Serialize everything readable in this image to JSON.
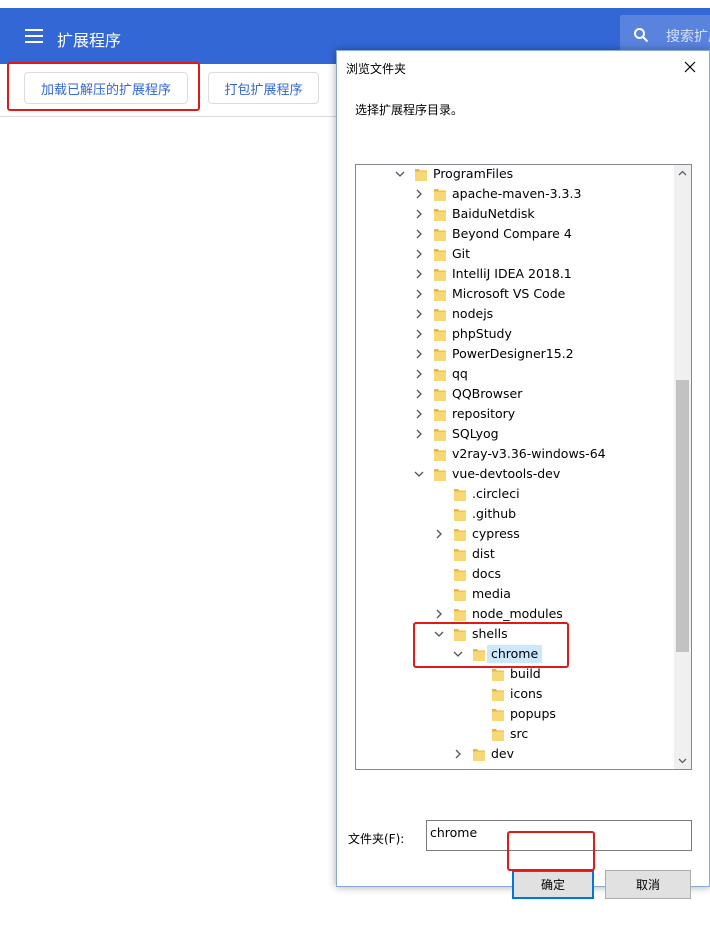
{
  "header": {
    "title": "扩展程序",
    "search_placeholder": "搜索扩展"
  },
  "toolbar": {
    "load_unpacked_label": "加载已解压的扩展程序",
    "pack_label": "打包扩展程序"
  },
  "dialog": {
    "title": "浏览文件夹",
    "instruction": "选择扩展程序目录。",
    "tree": [
      {
        "label": "ProgramFiles",
        "depth": 0,
        "expander": "expanded"
      },
      {
        "label": "apache-maven-3.3.3",
        "depth": 1,
        "expander": "collapsed"
      },
      {
        "label": "BaiduNetdisk",
        "depth": 1,
        "expander": "collapsed"
      },
      {
        "label": "Beyond Compare 4",
        "depth": 1,
        "expander": "collapsed"
      },
      {
        "label": "Git",
        "depth": 1,
        "expander": "collapsed"
      },
      {
        "label": "IntelliJ IDEA 2018.1",
        "depth": 1,
        "expander": "collapsed"
      },
      {
        "label": "Microsoft VS Code",
        "depth": 1,
        "expander": "collapsed"
      },
      {
        "label": "nodejs",
        "depth": 1,
        "expander": "collapsed"
      },
      {
        "label": "phpStudy",
        "depth": 1,
        "expander": "collapsed"
      },
      {
        "label": "PowerDesigner15.2",
        "depth": 1,
        "expander": "collapsed"
      },
      {
        "label": "qq",
        "depth": 1,
        "expander": "collapsed"
      },
      {
        "label": "QQBrowser",
        "depth": 1,
        "expander": "collapsed"
      },
      {
        "label": "repository",
        "depth": 1,
        "expander": "collapsed"
      },
      {
        "label": "SQLyog",
        "depth": 1,
        "expander": "collapsed"
      },
      {
        "label": "v2ray-v3.36-windows-64",
        "depth": 1,
        "expander": "none"
      },
      {
        "label": "vue-devtools-dev",
        "depth": 1,
        "expander": "expanded"
      },
      {
        "label": ".circleci",
        "depth": 2,
        "expander": "none"
      },
      {
        "label": ".github",
        "depth": 2,
        "expander": "none"
      },
      {
        "label": "cypress",
        "depth": 2,
        "expander": "collapsed"
      },
      {
        "label": "dist",
        "depth": 2,
        "expander": "none"
      },
      {
        "label": "docs",
        "depth": 2,
        "expander": "none"
      },
      {
        "label": "media",
        "depth": 2,
        "expander": "none"
      },
      {
        "label": "node_modules",
        "depth": 2,
        "expander": "collapsed"
      },
      {
        "label": "shells",
        "depth": 2,
        "expander": "expanded"
      },
      {
        "label": "chrome",
        "depth": 3,
        "expander": "expanded",
        "selected": true
      },
      {
        "label": "build",
        "depth": 4,
        "expander": "none"
      },
      {
        "label": "icons",
        "depth": 4,
        "expander": "none"
      },
      {
        "label": "popups",
        "depth": 4,
        "expander": "none"
      },
      {
        "label": "src",
        "depth": 4,
        "expander": "none"
      },
      {
        "label": "dev",
        "depth": 3,
        "expander": "collapsed"
      }
    ],
    "folder_label": "文件夹(F):",
    "folder_value": "chrome",
    "ok_label": "确定",
    "cancel_label": "取消"
  },
  "colors": {
    "header_blue": "#3367d6",
    "highlight_red": "#e0191b",
    "selection": "#cce8ff",
    "folder_yellow": "#f8d775"
  }
}
